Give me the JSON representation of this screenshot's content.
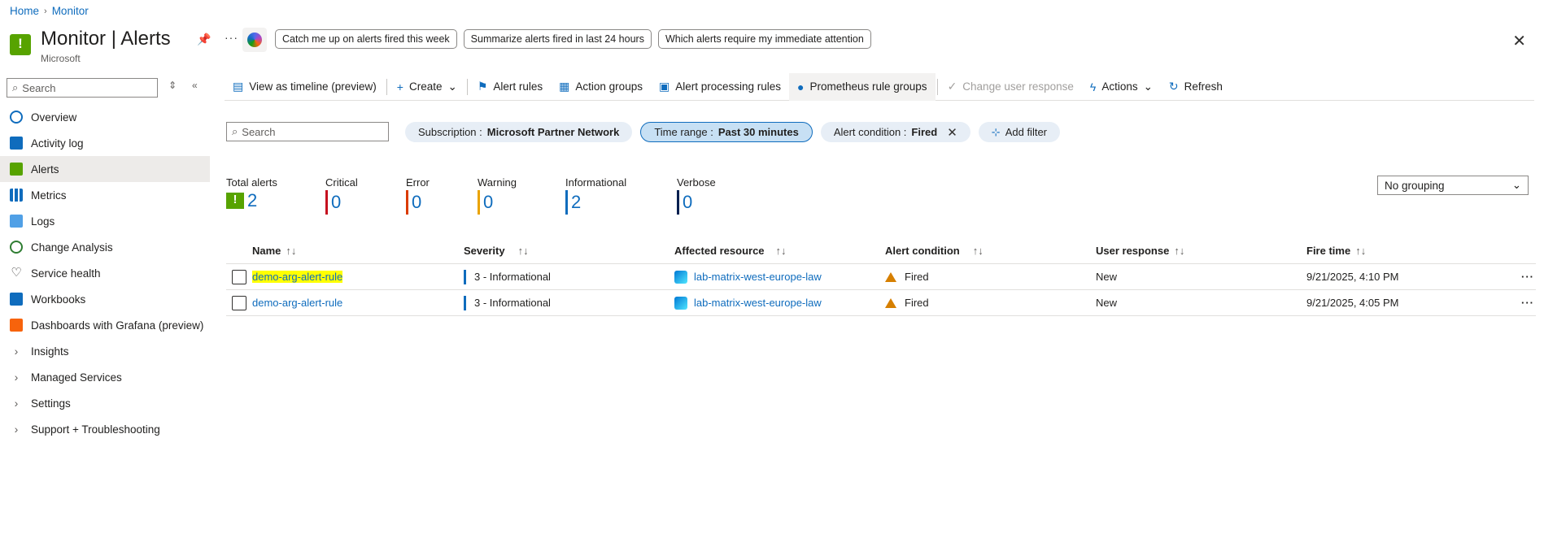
{
  "breadcrumb": {
    "home": "Home",
    "monitor": "Monitor"
  },
  "header": {
    "title": "Monitor | Alerts",
    "subtitle": "Microsoft",
    "prompts": [
      "Catch me up on alerts fired this week",
      "Summarize alerts fired in last 24 hours",
      "Which alerts require my immediate attention"
    ]
  },
  "sidebar": {
    "search_placeholder": "Search",
    "items": [
      {
        "label": "Overview"
      },
      {
        "label": "Activity log"
      },
      {
        "label": "Alerts"
      },
      {
        "label": "Metrics"
      },
      {
        "label": "Logs"
      },
      {
        "label": "Change Analysis"
      },
      {
        "label": "Service health"
      },
      {
        "label": "Workbooks"
      },
      {
        "label": "Dashboards with Grafana (preview)"
      },
      {
        "label": "Insights"
      },
      {
        "label": "Managed Services"
      },
      {
        "label": "Settings"
      },
      {
        "label": "Support + Troubleshooting"
      }
    ]
  },
  "toolbar": {
    "timeline": "View as timeline (preview)",
    "create": "Create",
    "alert_rules": "Alert rules",
    "action_groups": "Action groups",
    "processing_rules": "Alert processing rules",
    "prometheus": "Prometheus rule groups",
    "change_response": "Change user response",
    "actions": "Actions",
    "refresh": "Refresh"
  },
  "filters": {
    "search_placeholder": "Search",
    "subscription_label": "Subscription : ",
    "subscription_value": "Microsoft Partner Network",
    "time_label": "Time range : ",
    "time_value": "Past 30 minutes",
    "condition_label": "Alert condition : ",
    "condition_value": "Fired",
    "add_filter": "Add filter"
  },
  "summary": {
    "total": {
      "label": "Total alerts",
      "value": "2"
    },
    "critical": {
      "label": "Critical",
      "value": "0",
      "color": "#c50f1f"
    },
    "error": {
      "label": "Error",
      "value": "0",
      "color": "#da3b01"
    },
    "warning": {
      "label": "Warning",
      "value": "0",
      "color": "#eaa300"
    },
    "informational": {
      "label": "Informational",
      "value": "2",
      "color": "#0f6cbd"
    },
    "verbose": {
      "label": "Verbose",
      "value": "0",
      "color": "#002050"
    }
  },
  "grouping": "No grouping",
  "table": {
    "headers": {
      "name": "Name",
      "severity": "Severity",
      "resource": "Affected resource",
      "condition": "Alert condition",
      "response": "User response",
      "fire_time": "Fire time"
    },
    "rows": [
      {
        "name": "demo-arg-alert-rule",
        "severity": "3 - Informational",
        "resource": "lab-matrix-west-europe-law",
        "condition": "Fired",
        "response": "New",
        "fire_time": "9/21/2025, 4:10 PM"
      },
      {
        "name": "demo-arg-alert-rule",
        "severity": "3 - Informational",
        "resource": "lab-matrix-west-europe-law",
        "condition": "Fired",
        "response": "New",
        "fire_time": "9/21/2025, 4:05 PM"
      }
    ]
  }
}
